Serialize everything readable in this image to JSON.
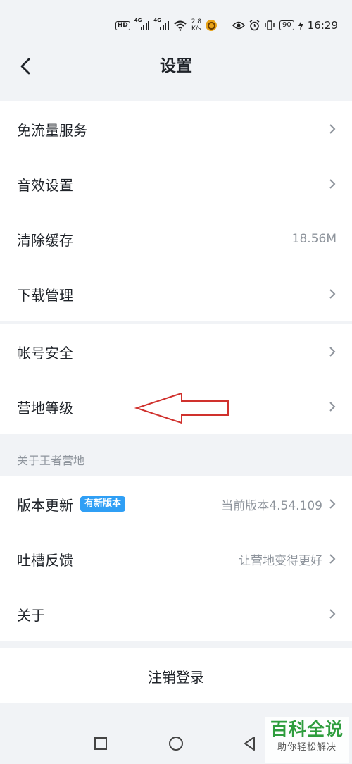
{
  "status_bar": {
    "hd": "HD",
    "sim1": "4G",
    "sim2": "4G",
    "speed_value": "2.8",
    "speed_unit": "K/s",
    "battery": "90",
    "time": "16:29",
    "icons": [
      "hd-icon",
      "signal-icon",
      "signal-icon",
      "wifi-icon",
      "app-icon",
      "eye-icon",
      "alarm-icon",
      "vibrate-icon",
      "battery-icon",
      "charging-icon"
    ]
  },
  "header": {
    "title": "设置",
    "back_icon": "chevron-left-icon"
  },
  "groups": {
    "general": [
      {
        "label": "免流量服务",
        "value": "",
        "chevron": true
      },
      {
        "label": "音效设置",
        "value": "",
        "chevron": true
      },
      {
        "label": "清除缓存",
        "value": "18.56M",
        "chevron": false
      },
      {
        "label": "下载管理",
        "value": "",
        "chevron": true
      }
    ],
    "account": [
      {
        "label": "帐号安全",
        "value": "",
        "chevron": true
      },
      {
        "label": "营地等级",
        "value": "",
        "chevron": true
      }
    ],
    "about_section_title": "关于王者营地",
    "about": [
      {
        "label": "版本更新",
        "badge": "有新版本",
        "value": "当前版本4.54.109",
        "chevron": true
      },
      {
        "label": "吐槽反馈",
        "value": "让营地变得更好",
        "chevron": true
      },
      {
        "label": "关于",
        "value": "",
        "chevron": true
      }
    ]
  },
  "logout_label": "注销登录",
  "annotation": {
    "arrow_color": "#d0312d"
  },
  "system_nav": [
    "square-icon",
    "circle-icon",
    "triangle-back-icon"
  ],
  "watermark": {
    "main": "百科全说",
    "sub": "助你轻松解决"
  },
  "colors": {
    "accent_badge": "#2f9ff5",
    "background": "#f1f3f6",
    "watermark_green": "#2e9d3d"
  }
}
